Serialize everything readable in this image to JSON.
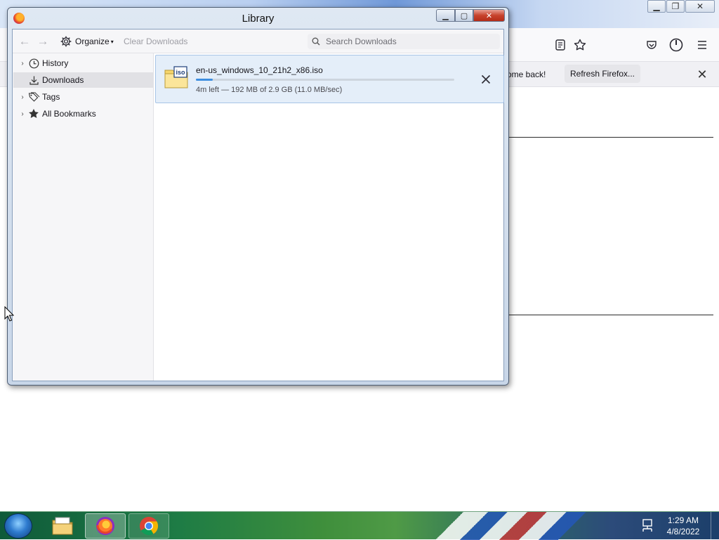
{
  "background_browser": {
    "notification_text": "ome back!",
    "refresh_button_label": "Refresh Firefox...",
    "toolbar_icons": [
      "reader-view-icon",
      "bookmark-star-icon",
      "pocket-icon",
      "account-icon",
      "menu-icon"
    ]
  },
  "library_window": {
    "title": "Library",
    "toolbar": {
      "organize_label": "Organize",
      "clear_downloads_label": "Clear Downloads",
      "search_placeholder": "Search Downloads"
    },
    "sidebar": {
      "items": [
        {
          "label": "History",
          "icon": "clock-icon",
          "expandable": true,
          "selected": false
        },
        {
          "label": "Downloads",
          "icon": "download-icon",
          "expandable": false,
          "selected": true
        },
        {
          "label": "Tags",
          "icon": "tag-icon",
          "expandable": true,
          "selected": false
        },
        {
          "label": "All Bookmarks",
          "icon": "star-icon",
          "expandable": true,
          "selected": false
        }
      ]
    },
    "downloads": [
      {
        "file_icon_text": "iso",
        "filename": "en-us_windows_10_21h2_x86.iso",
        "status": "4m left — 192 MB of 2.9 GB (11.0 MB/sec)",
        "progress_percent": 6.5
      }
    ]
  },
  "taskbar": {
    "pinned": [
      "windows-explorer-icon",
      "firefox-icon",
      "chrome-icon"
    ],
    "clock": {
      "time": "1:29 AM",
      "date": "4/8/2022"
    }
  },
  "colors": {
    "selection_bg": "#e1e1e5",
    "download_item_bg": "#e4eef9",
    "progress_fill": "#3d8ee0",
    "close_button": "#c7422c"
  }
}
